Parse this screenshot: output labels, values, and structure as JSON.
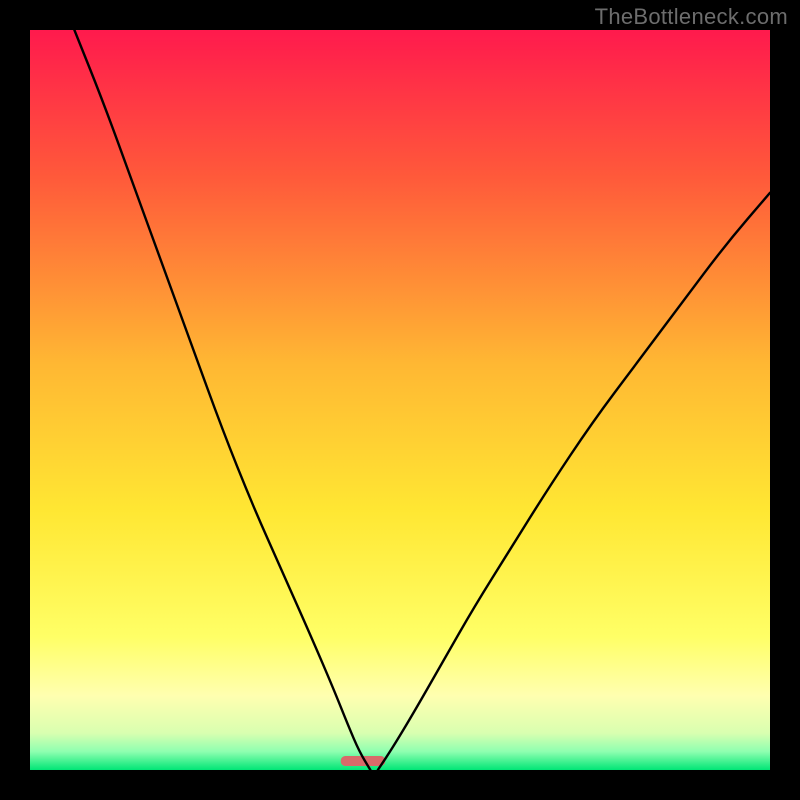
{
  "watermark": "TheBottleneck.com",
  "chart_data": {
    "type": "line",
    "title": "",
    "xlabel": "",
    "ylabel": "",
    "xlim": [
      0,
      100
    ],
    "ylim": [
      0,
      100
    ],
    "grid": false,
    "annotations": [],
    "background_gradient": {
      "stops": [
        {
          "offset": 0.0,
          "color": "#ff1a4d"
        },
        {
          "offset": 0.2,
          "color": "#ff5a3a"
        },
        {
          "offset": 0.45,
          "color": "#ffb733"
        },
        {
          "offset": 0.65,
          "color": "#ffe733"
        },
        {
          "offset": 0.82,
          "color": "#ffff66"
        },
        {
          "offset": 0.9,
          "color": "#ffffb0"
        },
        {
          "offset": 0.95,
          "color": "#d9ffb0"
        },
        {
          "offset": 0.975,
          "color": "#8fffb0"
        },
        {
          "offset": 1.0,
          "color": "#00e676"
        }
      ]
    },
    "optimal_marker": {
      "x": 45,
      "width": 6,
      "color": "#d86a6a",
      "radius": 1.5
    },
    "series": [
      {
        "name": "left-branch",
        "x": [
          6,
          10,
          14,
          18,
          22,
          26,
          30,
          34,
          38,
          41,
          43,
          44.5,
          46
        ],
        "y": [
          100,
          90,
          79,
          68,
          57,
          46,
          36,
          27,
          18,
          11,
          6,
          2.5,
          0
        ]
      },
      {
        "name": "right-branch",
        "x": [
          47,
          49,
          52,
          56,
          60,
          65,
          70,
          76,
          82,
          88,
          94,
          100
        ],
        "y": [
          0,
          3,
          8,
          15,
          22,
          30,
          38,
          47,
          55,
          63,
          71,
          78
        ]
      }
    ]
  }
}
